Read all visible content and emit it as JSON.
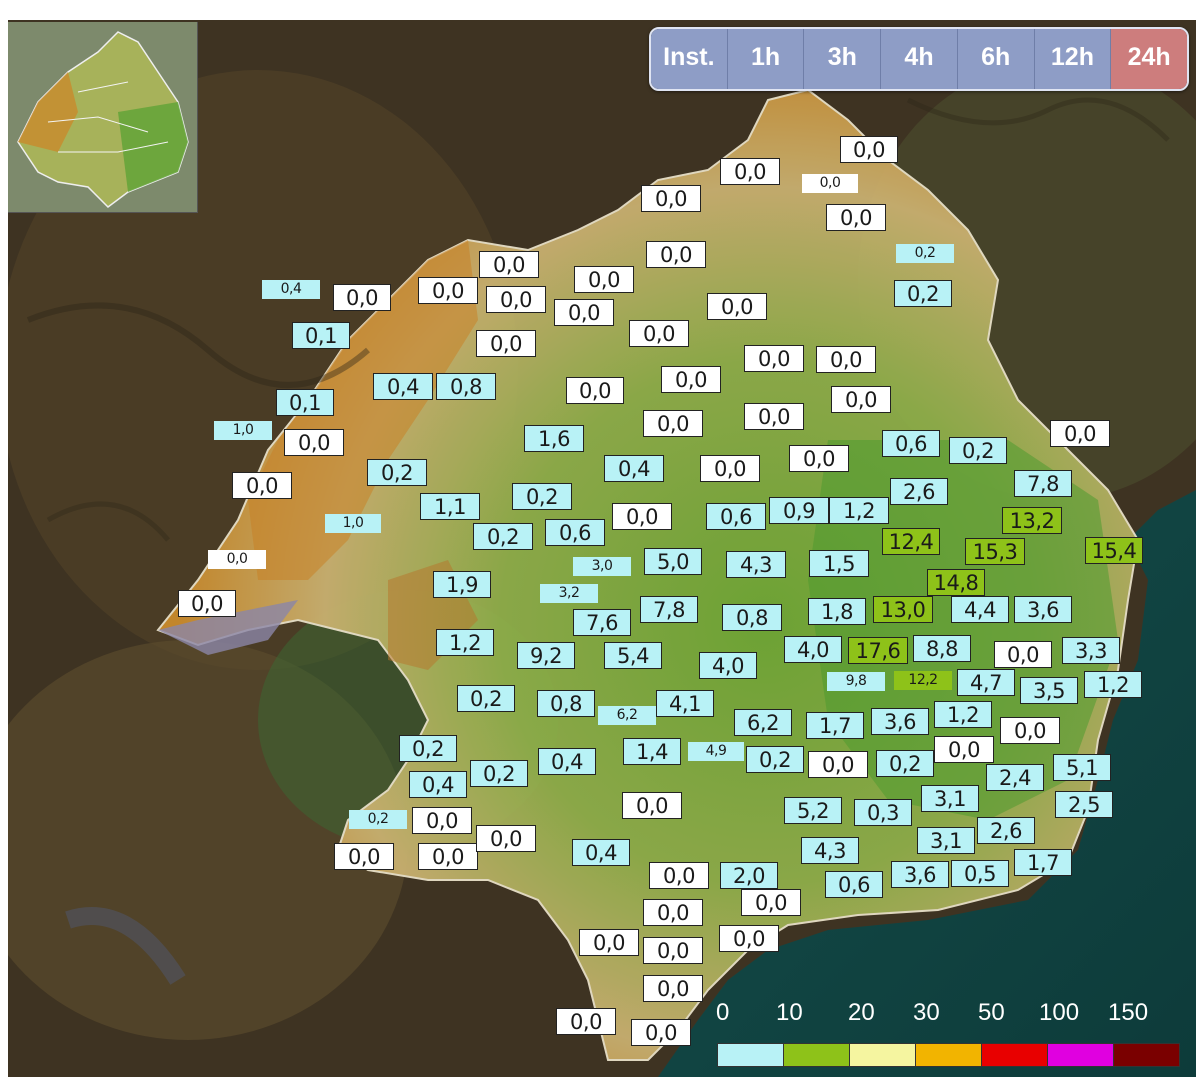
{
  "tabs": [
    {
      "label": "Inst.",
      "active": false
    },
    {
      "label": "1h",
      "active": false
    },
    {
      "label": "3h",
      "active": false
    },
    {
      "label": "4h",
      "active": false
    },
    {
      "label": "6h",
      "active": false
    },
    {
      "label": "12h",
      "active": false
    },
    {
      "label": "24h",
      "active": true
    }
  ],
  "legend": {
    "ticks": [
      "0",
      "10",
      "20",
      "30",
      "50",
      "100",
      "150"
    ],
    "colors": [
      "#b8f2f6",
      "#8ec219",
      "#f5f5a0",
      "#f2b400",
      "#e80000",
      "#e000e0",
      "#7a0000"
    ]
  },
  "class_colors": {
    "white": "#ffffff",
    "cyan": "#b8f2f6",
    "green": "#8ec219"
  },
  "stations": [
    {
      "v": "0,0",
      "c": "c0"
    },
    {
      "v": "0,0",
      "c": "c0"
    },
    {
      "v": "0,0",
      "c": "c0"
    },
    {
      "v": "0,0",
      "c": "c0"
    },
    {
      "v": "0,0",
      "c": "c0"
    },
    {
      "v": "0,2",
      "c": "c1"
    },
    {
      "v": "0,2",
      "c": "c1"
    },
    {
      "v": "0,0",
      "c": "c0"
    },
    {
      "v": "0,4",
      "c": "c1"
    },
    {
      "v": "0,0",
      "c": "c0"
    },
    {
      "v": "0,0",
      "c": "c0"
    },
    {
      "v": "0,0",
      "c": "c0"
    },
    {
      "v": "0,0",
      "c": "c0"
    },
    {
      "v": "0,0",
      "c": "c0"
    },
    {
      "v": "0,0",
      "c": "c0"
    },
    {
      "v": "0,0",
      "c": "c0"
    },
    {
      "v": "0,0",
      "c": "c0"
    },
    {
      "v": "0,1",
      "c": "c1"
    },
    {
      "v": "0,0",
      "c": "c0"
    },
    {
      "v": "0,0",
      "c": "c0"
    },
    {
      "v": "0,0",
      "c": "c0"
    },
    {
      "v": "0,0",
      "c": "c0"
    },
    {
      "v": "0,4",
      "c": "c1"
    },
    {
      "v": "0,8",
      "c": "c1"
    },
    {
      "v": "0,0",
      "c": "c0"
    },
    {
      "v": "0,0",
      "c": "c0"
    },
    {
      "v": "0,0",
      "c": "c0"
    },
    {
      "v": "0,1",
      "c": "c1"
    },
    {
      "v": "0,0",
      "c": "c0"
    },
    {
      "v": "0,0",
      "c": "c0"
    },
    {
      "v": "1,0",
      "c": "c1"
    },
    {
      "v": "0,0",
      "c": "c0"
    },
    {
      "v": "1,6",
      "c": "c1"
    },
    {
      "v": "0,6",
      "c": "c1"
    },
    {
      "v": "0,2",
      "c": "c1"
    },
    {
      "v": "0,0",
      "c": "c0"
    },
    {
      "v": "0,2",
      "c": "c1"
    },
    {
      "v": "0,4",
      "c": "c1"
    },
    {
      "v": "0,0",
      "c": "c0"
    },
    {
      "v": "0,0",
      "c": "c0"
    },
    {
      "v": "7,8",
      "c": "c1"
    },
    {
      "v": "0,0",
      "c": "c0"
    },
    {
      "v": "2,6",
      "c": "c1"
    },
    {
      "v": "1,1",
      "c": "c1"
    },
    {
      "v": "0,2",
      "c": "c1"
    },
    {
      "v": "1,0",
      "c": "c1"
    },
    {
      "v": "0,2",
      "c": "c1"
    },
    {
      "v": "0,6",
      "c": "c1"
    },
    {
      "v": "0,0",
      "c": "c0"
    },
    {
      "v": "0,6",
      "c": "c1"
    },
    {
      "v": "0,9",
      "c": "c1"
    },
    {
      "v": "1,2",
      "c": "c1"
    },
    {
      "v": "13,2",
      "c": "c2"
    },
    {
      "v": "12,4",
      "c": "c2"
    },
    {
      "v": "15,3",
      "c": "c2"
    },
    {
      "v": "15,4",
      "c": "c2"
    },
    {
      "v": "0,0",
      "c": "c0"
    },
    {
      "v": "3,0",
      "c": "c1"
    },
    {
      "v": "5,0",
      "c": "c1"
    },
    {
      "v": "4,3",
      "c": "c1"
    },
    {
      "v": "1,5",
      "c": "c1"
    },
    {
      "v": "14,8",
      "c": "c2"
    },
    {
      "v": "0,0",
      "c": "c0"
    },
    {
      "v": "1,9",
      "c": "c1"
    },
    {
      "v": "3,2",
      "c": "c1"
    },
    {
      "v": "7,8",
      "c": "c1"
    },
    {
      "v": "7,6",
      "c": "c1"
    },
    {
      "v": "0,8",
      "c": "c1"
    },
    {
      "v": "1,8",
      "c": "c1"
    },
    {
      "v": "13,0",
      "c": "c2"
    },
    {
      "v": "4,4",
      "c": "c1"
    },
    {
      "v": "3,6",
      "c": "c1"
    },
    {
      "v": "1,2",
      "c": "c1"
    },
    {
      "v": "9,2",
      "c": "c1"
    },
    {
      "v": "5,4",
      "c": "c1"
    },
    {
      "v": "4,0",
      "c": "c1"
    },
    {
      "v": "4,0",
      "c": "c1"
    },
    {
      "v": "17,6",
      "c": "c2"
    },
    {
      "v": "8,8",
      "c": "c1"
    },
    {
      "v": "0,0",
      "c": "c0"
    },
    {
      "v": "3,3",
      "c": "c1"
    },
    {
      "v": "9,8",
      "c": "c1"
    },
    {
      "v": "12,2",
      "c": "c2"
    },
    {
      "v": "4,7",
      "c": "c1"
    },
    {
      "v": "3,5",
      "c": "c1"
    },
    {
      "v": "1,2",
      "c": "c1"
    },
    {
      "v": "0,2",
      "c": "c1"
    },
    {
      "v": "0,8",
      "c": "c1"
    },
    {
      "v": "4,1",
      "c": "c1"
    },
    {
      "v": "6,2",
      "c": "c1"
    },
    {
      "v": "6,2",
      "c": "c1"
    },
    {
      "v": "1,7",
      "c": "c1"
    },
    {
      "v": "3,6",
      "c": "c1"
    },
    {
      "v": "1,2",
      "c": "c1"
    },
    {
      "v": "0,0",
      "c": "c0"
    },
    {
      "v": "0,2",
      "c": "c1"
    },
    {
      "v": "0,4",
      "c": "c1"
    },
    {
      "v": "1,4",
      "c": "c1"
    },
    {
      "v": "4,9",
      "c": "c1"
    },
    {
      "v": "0,2",
      "c": "c1"
    },
    {
      "v": "0,0",
      "c": "c0"
    },
    {
      "v": "0,2",
      "c": "c1"
    },
    {
      "v": "0,0",
      "c": "c0"
    },
    {
      "v": "2,4",
      "c": "c1"
    },
    {
      "v": "5,1",
      "c": "c1"
    },
    {
      "v": "0,4",
      "c": "c1"
    },
    {
      "v": "0,2",
      "c": "c1"
    },
    {
      "v": "3,1",
      "c": "c1"
    },
    {
      "v": "2,5",
      "c": "c1"
    },
    {
      "v": "0,0",
      "c": "c0"
    },
    {
      "v": "5,2",
      "c": "c1"
    },
    {
      "v": "0,3",
      "c": "c1"
    },
    {
      "v": "0,2",
      "c": "c1"
    },
    {
      "v": "0,0",
      "c": "c0"
    },
    {
      "v": "0,0",
      "c": "c0"
    },
    {
      "v": "0,0",
      "c": "c0"
    },
    {
      "v": "0,0",
      "c": "c0"
    },
    {
      "v": "0,4",
      "c": "c1"
    },
    {
      "v": "4,3",
      "c": "c1"
    },
    {
      "v": "3,1",
      "c": "c1"
    },
    {
      "v": "2,6",
      "c": "c1"
    },
    {
      "v": "0,0",
      "c": "c0"
    },
    {
      "v": "2,0",
      "c": "c1"
    },
    {
      "v": "0,6",
      "c": "c1"
    },
    {
      "v": "3,6",
      "c": "c1"
    },
    {
      "v": "0,5",
      "c": "c1"
    },
    {
      "v": "1,7",
      "c": "c1"
    },
    {
      "v": "0,0",
      "c": "c0"
    },
    {
      "v": "0,0",
      "c": "c0"
    },
    {
      "v": "0,0",
      "c": "c0"
    },
    {
      "v": "0,0",
      "c": "c0"
    },
    {
      "v": "0,0",
      "c": "c0"
    },
    {
      "v": "0,0",
      "c": "c0"
    },
    {
      "v": "0,0",
      "c": "c0"
    },
    {
      "v": "0,0",
      "c": "c0"
    }
  ]
}
